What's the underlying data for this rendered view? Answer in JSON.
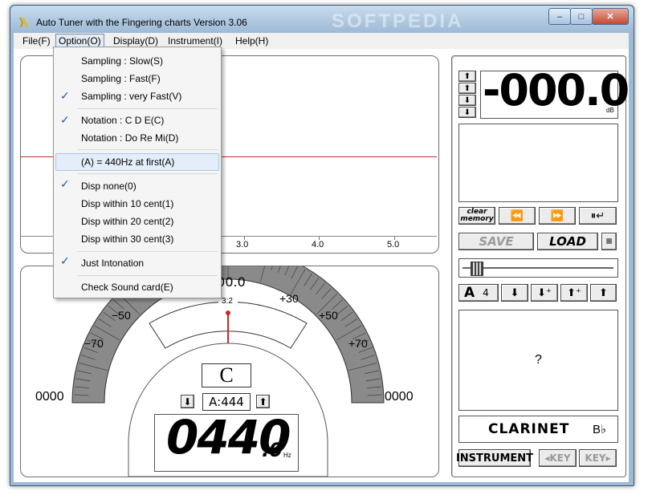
{
  "window": {
    "title": "Auto Tuner with the Fingering charts  Version 3.06",
    "watermark": "SOFTPEDIA",
    "controls": {
      "minimize": "–",
      "maximize": "□",
      "close": "✕"
    }
  },
  "menubar": [
    "File(F)",
    "Option(O)",
    "Display(D)",
    "Instrument(I)",
    "Help(H)"
  ],
  "option_menu": {
    "items": [
      {
        "label": "Sampling : Slow(S)",
        "checked": false
      },
      {
        "label": "Sampling : Fast(F)",
        "checked": false
      },
      {
        "label": "Sampling : very Fast(V)",
        "checked": true
      },
      {
        "label": "Notation : C D E(C)",
        "checked": true
      },
      {
        "label": "Notation : Do Re Mi(D)",
        "checked": false
      },
      {
        "label": "(A) = 440Hz at first(A)",
        "checked": false
      },
      {
        "label": "Disp none(0)",
        "checked": true
      },
      {
        "label": "Disp within 10 cent(1)",
        "checked": false
      },
      {
        "label": "Disp within 20 cent(2)",
        "checked": false
      },
      {
        "label": "Disp within 30 cent(3)",
        "checked": false
      },
      {
        "label": "Just Intonation",
        "checked": true
      },
      {
        "label": "Check Sound card(E)",
        "checked": false
      }
    ],
    "check_glyph": "✓"
  },
  "graph": {
    "x_ticks": [
      "3.0",
      "4.0",
      "5.0"
    ]
  },
  "gauge": {
    "top_value": "000.0",
    "ratio": "3:2",
    "labels": {
      "m50": "−50",
      "p30": "+30",
      "p50": "+50",
      "m70": "−70",
      "p70": "+70"
    },
    "left_value": "0000",
    "right_value": "0000",
    "note": "C",
    "pitch_ref": "A:444",
    "freq_main": "0440",
    "freq_dec": ".0",
    "freq_unit": "Hz"
  },
  "right_panel": {
    "db_value": "-000.0",
    "db_unit": "dB",
    "clear_memory": [
      "clear",
      "memory"
    ],
    "save": "SAVE",
    "load": "LOAD",
    "transpose_letter": "A",
    "transpose_num": "4",
    "question": "?",
    "instrument_name": "CLARINET",
    "instrument_key": "B♭",
    "instrument_btn": "INSTRUMENT",
    "key_down": "◂KEY",
    "key_up": "KEY▸"
  },
  "icons": [
    "app-tuning-fork-icon",
    "arrow-up-icon",
    "arrow-down-icon",
    "rewind-icon",
    "forward-icon",
    "pause-return-icon",
    "stop-icon"
  ]
}
